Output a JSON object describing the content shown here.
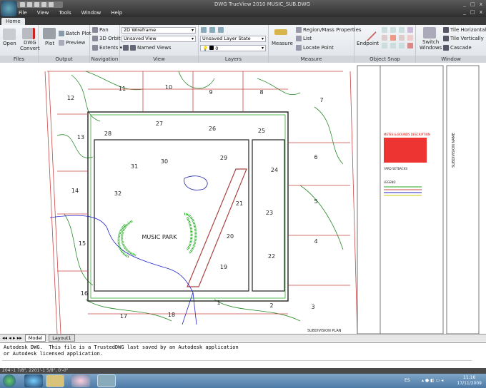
{
  "window": {
    "title": "DWG TrueView 2010   MUSIC_SUB.DWG",
    "controls": "_ □ x"
  },
  "menu": [
    "File",
    "View",
    "Tools",
    "Window",
    "Help"
  ],
  "tabs": [
    "Home"
  ],
  "ribbon": {
    "files": {
      "label": "Files",
      "open": "Open",
      "convert": "DWG Convert"
    },
    "output": {
      "label": "Output",
      "plot": "Plot",
      "batch_plot": "Batch Plot",
      "preview": "Preview"
    },
    "navigation": {
      "label": "Navigation",
      "pan": "Pan",
      "orbit": "3D Orbit",
      "extents": "Extents"
    },
    "view": {
      "label": "View",
      "visual_style": "2D Wireframe",
      "view": "Unsaved View",
      "named_views": "Named Views"
    },
    "layers": {
      "label": "Layers",
      "layer_state": "Unsaved Layer State",
      "layer": "0"
    },
    "measure": {
      "label": "Measure",
      "measure": "Measure",
      "region": "Region/Mass Properties",
      "list": "List",
      "locate": "Locate Point"
    },
    "osnap": {
      "label": "Object Snap",
      "endpoint": "Endpoint"
    },
    "window": {
      "label": "Window",
      "switch": "Switch Windows",
      "tile_h": "Tile Horizontally",
      "tile_v": "Tile Vertically",
      "cascade": "Cascade"
    }
  },
  "drawing": {
    "lots": [
      "12",
      "11",
      "10",
      "9",
      "8",
      "7",
      "13",
      "28",
      "27",
      "26",
      "25",
      "6",
      "14",
      "31",
      "30",
      "29",
      "24",
      "32",
      "5",
      "21",
      "23",
      "15",
      "20",
      "4",
      "22",
      "19",
      "16",
      "17",
      "18",
      "1",
      "2",
      "3"
    ],
    "park_label": "MUSIC PARK",
    "plan_label": "SUBDIVISION PLAN",
    "notes_title": "METES & BOUNDS DESCRIPTION",
    "setbacks_title": "YARD SETBACKS",
    "legend_title": "LEGEND",
    "subdivision_name": "SUBDIVISION NAME"
  },
  "layout_tabs": [
    "Model",
    "Layout1"
  ],
  "command": {
    "lines": [
      "Autodesk DWG.  This file is a TrustedDWG last saved by an Autodesk application",
      "or Autodesk licensed application."
    ]
  },
  "status": {
    "coords": "204'-1 7/8\", 2201'-1 5/8\", 0'-0\""
  },
  "taskbar": {
    "lang": "ES",
    "time": "11:16",
    "date": "17/11/2009"
  }
}
